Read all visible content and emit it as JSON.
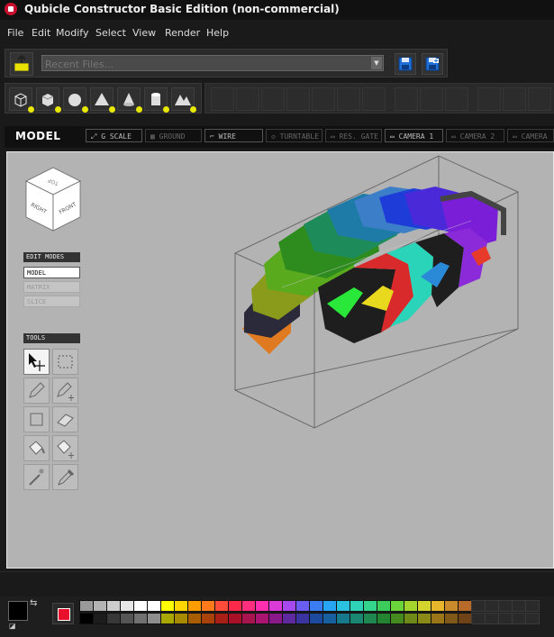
{
  "window": {
    "title": "Qubicle Constructor Basic Edition (non-commercial)"
  },
  "menu": [
    "File",
    "Edit",
    "Modify",
    "Select",
    "View",
    "Render",
    "Help"
  ],
  "filebar": {
    "recent_placeholder": "Recent Files..."
  },
  "viewbar": {
    "mode_label": "MODEL",
    "buttons": [
      "G SCALE",
      "GROUND",
      "WIRE",
      "TURNTABLE",
      "RES. GATE",
      "CAMERA 1",
      "CAMERA 2",
      "CAMERA"
    ]
  },
  "navcube": {
    "top": "TOP",
    "right": "RIGHT",
    "front": "FRONT"
  },
  "edit_modes": {
    "header": "EDIT MODES",
    "items": [
      "MODEL",
      "MATRIX",
      "SLICE"
    ]
  },
  "tools": {
    "header": "TOOLS"
  },
  "colors": {
    "current_color": "#000000",
    "secondary_color": "#ffffff",
    "active_swatch": "#e8102a",
    "palette_top": [
      "#9a9a9a",
      "#b4b4b4",
      "#cdcdcd",
      "#e6e6e6",
      "#ffffff",
      "#ffffff",
      "#ffff00",
      "#ffd700",
      "#ff9d00",
      "#ff7a1a",
      "#ff4b3a",
      "#ff2a4a",
      "#ff2f7e",
      "#ff2fb0",
      "#d93ad8",
      "#a64af0",
      "#6a5df2",
      "#3a7cf2",
      "#27a4f2",
      "#2bc2e0",
      "#2fd4b8",
      "#35d48c",
      "#3ccc5c",
      "#6bd43a",
      "#a4d42e",
      "#d4d42e",
      "#e8b62a",
      "#c88a2a",
      "#b86a2a"
    ],
    "palette_bottom": [
      "#000000",
      "#1c1c1c",
      "#383838",
      "#555555",
      "#717171",
      "#8e8e8e",
      "#a8a800",
      "#a88a00",
      "#a85e00",
      "#a8420a",
      "#a81f16",
      "#a81028",
      "#a8144e",
      "#a81470",
      "#8a1a8a",
      "#5e2a9e",
      "#3a34a0",
      "#1e4a9e",
      "#175f9e",
      "#177a8c",
      "#1a8870",
      "#1e8850",
      "#228430",
      "#448a1e",
      "#6e8a18",
      "#8a8a18",
      "#9a7618",
      "#805818",
      "#704218"
    ]
  }
}
